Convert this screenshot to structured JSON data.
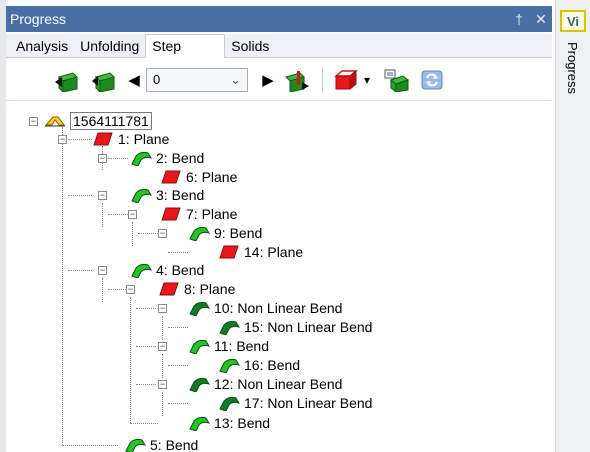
{
  "panel": {
    "title": "Progress",
    "pin_glyph": "†",
    "close_glyph": "✕"
  },
  "tabs": [
    {
      "label": "Analysis",
      "active": false
    },
    {
      "label": "Unfolding",
      "active": false
    },
    {
      "label": "Step",
      "active": true
    },
    {
      "label": "Solids",
      "active": false
    }
  ],
  "toolbar": {
    "step_value": "0",
    "prev_glyph": "◀",
    "next_glyph": "▶",
    "dropdown_glyph": "⌄",
    "solid_dropdown_glyph": "▾"
  },
  "tree": {
    "root": "1564111781",
    "nodes": [
      {
        "label": "1: Plane",
        "type": "plane"
      },
      {
        "label": "2: Bend",
        "type": "bend"
      },
      {
        "label": "6: Plane",
        "type": "plane"
      },
      {
        "label": "3: Bend",
        "type": "bend"
      },
      {
        "label": "7: Plane",
        "type": "plane"
      },
      {
        "label": "9: Bend",
        "type": "bend"
      },
      {
        "label": "14: Plane",
        "type": "plane"
      },
      {
        "label": "4: Bend",
        "type": "bend"
      },
      {
        "label": "8: Plane",
        "type": "plane"
      },
      {
        "label": "10: Non Linear Bend",
        "type": "nonlinear"
      },
      {
        "label": "15: Non Linear Bend",
        "type": "nonlinear"
      },
      {
        "label": "11: Bend",
        "type": "bend"
      },
      {
        "label": "16: Bend",
        "type": "bend"
      },
      {
        "label": "12: Non Linear Bend",
        "type": "nonlinear"
      },
      {
        "label": "17: Non Linear Bend",
        "type": "nonlinear"
      },
      {
        "label": "13: Bend",
        "type": "bend"
      },
      {
        "label": "5: Bend",
        "type": "bend"
      }
    ]
  },
  "side": {
    "vi_label": "Vi",
    "progress_label": "Progress"
  },
  "colors": {
    "title_bar": "#4a6fa5",
    "plane": "#e8171b",
    "bend": "#22c522",
    "nonlinear": "#137a2a",
    "accent_yellow": "#e2c100"
  }
}
